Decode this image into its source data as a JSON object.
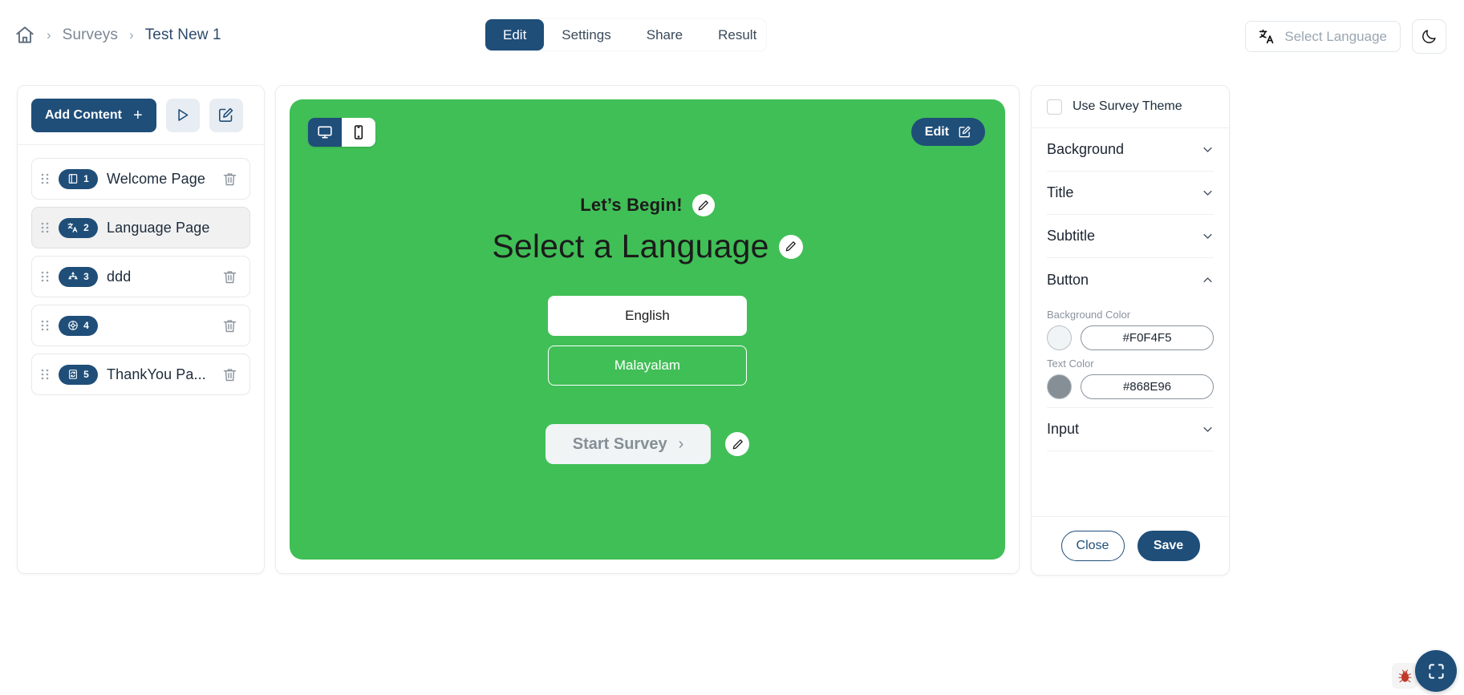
{
  "breadcrumb": {
    "home_icon": "home-icon",
    "separator": "›",
    "items": [
      {
        "label": "Surveys",
        "current": false
      },
      {
        "label": "Test New 1",
        "current": true
      }
    ]
  },
  "tabs": [
    {
      "label": "Edit",
      "active": true
    },
    {
      "label": "Settings",
      "active": false
    },
    {
      "label": "Share",
      "active": false
    },
    {
      "label": "Result",
      "active": false
    }
  ],
  "topright": {
    "language_selector": {
      "icon": "translate-icon",
      "label": "Select Language"
    },
    "theme_toggle": {
      "icon": "moon-icon"
    }
  },
  "sidebar": {
    "add_content_label": "Add Content",
    "add_content_plus": "+",
    "preview_icon": "play-icon",
    "edit_icon": "pencil-square-icon",
    "pages": [
      {
        "number": "1",
        "label": "Welcome Page",
        "icon": "book-icon",
        "selected": false,
        "deletable": true
      },
      {
        "number": "2",
        "label": "Language Page",
        "icon": "translate-icon",
        "selected": true,
        "deletable": false
      },
      {
        "number": "3",
        "label": "ddd",
        "icon": "sitemap-icon",
        "selected": false,
        "deletable": true
      },
      {
        "number": "4",
        "label": "",
        "icon": "wheel-icon",
        "selected": false,
        "deletable": true
      },
      {
        "number": "5",
        "label": "ThankYou Pa...",
        "icon": "page-refresh-icon",
        "selected": false,
        "deletable": true
      }
    ]
  },
  "stage": {
    "background_color": "#40BF56",
    "device_toggle": [
      {
        "name": "desktop",
        "icon": "desktop-icon",
        "active": true
      },
      {
        "name": "mobile",
        "icon": "mobile-icon",
        "active": false
      }
    ],
    "edit_button": {
      "label": "Edit",
      "icon": "pencil-square-icon"
    },
    "subtitle": "Let’s Begin!",
    "title": "Select a Language",
    "options": [
      {
        "label": "English",
        "selected": true
      },
      {
        "label": "Malayalam",
        "selected": false
      }
    ],
    "start_button": {
      "label": "Start Survey",
      "chevron": "›",
      "bg": "#F0F4F5",
      "text_color": "#868E96"
    }
  },
  "rightpanel": {
    "use_survey_theme": {
      "label": "Use Survey Theme",
      "checked": false
    },
    "sections": [
      {
        "title": "Background",
        "expanded": false
      },
      {
        "title": "Title",
        "expanded": false
      },
      {
        "title": "Subtitle",
        "expanded": false
      },
      {
        "title": "Button",
        "expanded": true
      },
      {
        "title": "Input",
        "expanded": false
      }
    ],
    "button_section": {
      "background_color_label": "Background Color",
      "background_color_value": "#F0F4F5",
      "text_color_label": "Text Color",
      "text_color_value": "#868E96"
    },
    "footer": {
      "close_label": "Close",
      "save_label": "Save"
    }
  },
  "floating": {
    "bug_icon": "bug-icon",
    "fullscreen_icon": "fullscreen-icon"
  }
}
